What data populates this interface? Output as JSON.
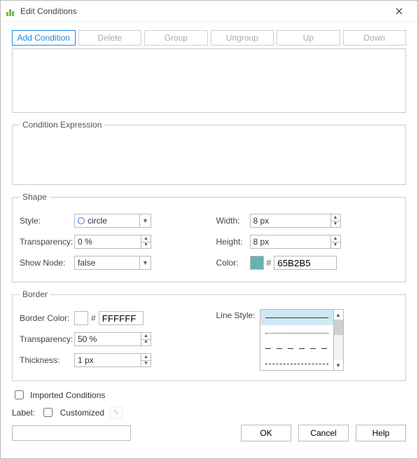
{
  "window": {
    "title": "Edit Conditions"
  },
  "toolbar": {
    "add": "Add Condition",
    "delete": "Delete",
    "group": "Group",
    "ungroup": "Ungroup",
    "up": "Up",
    "down": "Down"
  },
  "cond_expr": {
    "legend": "Condition Expression"
  },
  "shape": {
    "legend": "Shape",
    "style_label": "Style:",
    "style_value": "circle",
    "transparency_label": "Transparency:",
    "transparency_value": "0 %",
    "show_node_label": "Show Node:",
    "show_node_value": "false",
    "width_label": "Width:",
    "width_value": "8 px",
    "height_label": "Height:",
    "height_value": "8 px",
    "color_label": "Color:",
    "color_hex": "65B2B5",
    "color_swatch": "#65B2B5"
  },
  "border": {
    "legend": "Border",
    "border_color_label": "Border Color:",
    "border_color_hex": "FFFFFF",
    "border_color_swatch": "#FFFFFF",
    "transparency_label": "Transparency:",
    "transparency_value": "50 %",
    "thickness_label": "Thickness:",
    "thickness_value": "1 px",
    "line_style_label": "Line Style:"
  },
  "imported": {
    "label": "Imported Conditions",
    "checked": false
  },
  "labelrow": {
    "label_text": "Label:",
    "customized_text": "Customized",
    "customized_checked": false
  },
  "footer": {
    "ok": "OK",
    "cancel": "Cancel",
    "help": "Help"
  }
}
